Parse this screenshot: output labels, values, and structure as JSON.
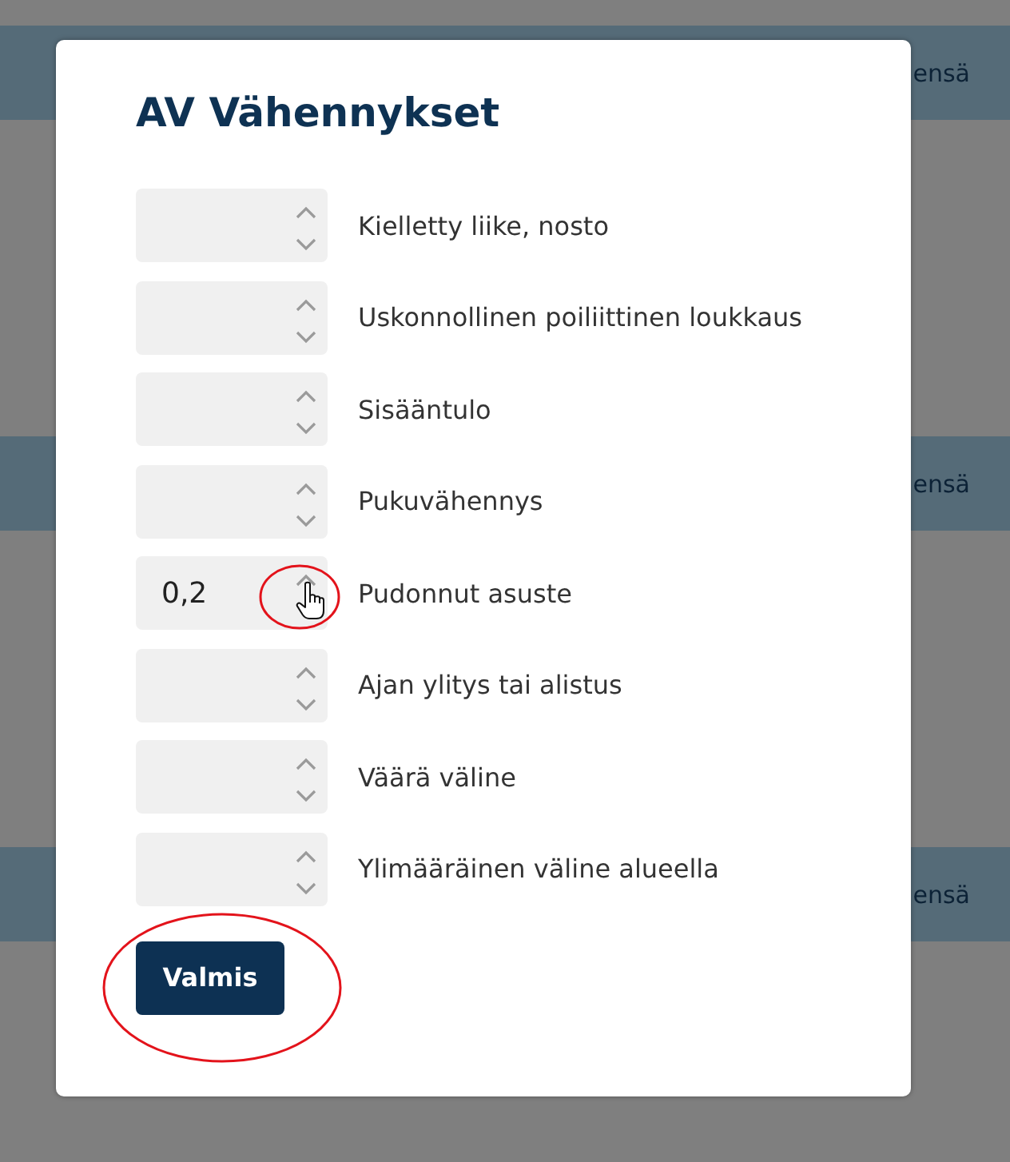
{
  "background": {
    "rows": [
      {
        "text": "ensä"
      },
      {
        "text": "ensä"
      },
      {
        "text": "ensä"
      }
    ]
  },
  "dialog": {
    "title": "AV Vähennykset",
    "fields": [
      {
        "label": "Kielletty liike, nosto",
        "annotated": false,
        "hovered": false
      },
      {
        "label": "Uskonnollinen poiliittinen loukkaus",
        "annotated": false,
        "hovered": false
      },
      {
        "label": "Sisääntulo",
        "annotated": false,
        "hovered": false
      },
      {
        "label": "Pukuvähennys",
        "annotated": false,
        "hovered": false
      },
      {
        "label": "Pudonnut asuste",
        "value": "0,2",
        "annotated": true,
        "hovered": true
      },
      {
        "label": "Ajan ylitys tai alistus",
        "annotated": false,
        "hovered": false
      },
      {
        "label": "Väärä väline",
        "annotated": false,
        "hovered": false
      },
      {
        "label": "Ylimääräinen väline alueella",
        "annotated": false,
        "hovered": false
      }
    ],
    "button": {
      "label": "Valmis",
      "annotated": true
    }
  }
}
